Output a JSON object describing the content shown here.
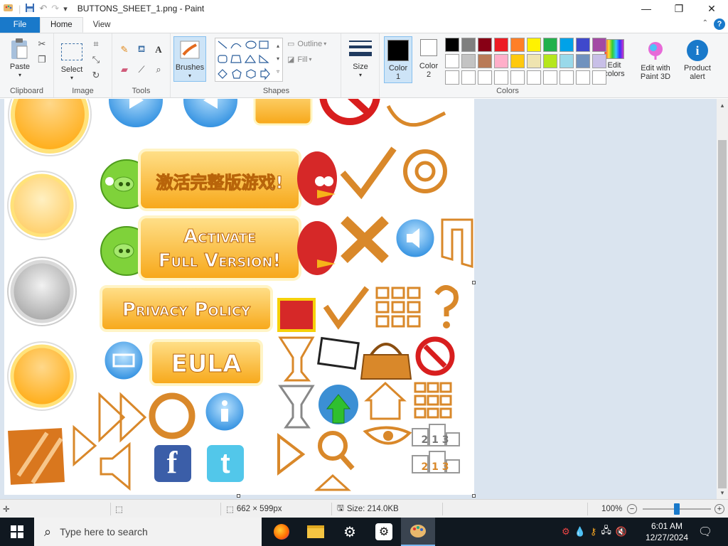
{
  "window": {
    "title": "BUTTONS_SHEET_1.png - Paint",
    "controls": {
      "minimize": "—",
      "maximize": "❐",
      "close": "✕"
    }
  },
  "quick_access": {
    "customize": "▾"
  },
  "tabs": [
    {
      "label": "File"
    },
    {
      "label": "Home"
    },
    {
      "label": "View"
    }
  ],
  "ribbon": {
    "clipboard": {
      "paste": "Paste",
      "group": "Clipboard"
    },
    "image": {
      "select": "Select",
      "group": "Image"
    },
    "tools": {
      "group": "Tools",
      "text": "A"
    },
    "brushes": {
      "label": "Brushes"
    },
    "shapes": {
      "group": "Shapes",
      "outline": "Outline",
      "fill": "Fill"
    },
    "size": {
      "label": "Size"
    },
    "colors": {
      "color1": "Color 1",
      "color2": "Color 2",
      "group": "Colors",
      "edit_colors": "Edit colors",
      "edit_paint3d": "Edit with Paint 3D",
      "product_alert": "Product alert",
      "palette_row1": [
        "#000000",
        "#7f7f7f",
        "#880015",
        "#ed1c24",
        "#ff7f27",
        "#fff200",
        "#22b14c",
        "#00a2e8",
        "#3f48cc",
        "#a349a4"
      ],
      "palette_row2": [
        "#ffffff",
        "#c3c3c3",
        "#b97a57",
        "#ffaec9",
        "#ffc90e",
        "#efe4b0",
        "#b5e61d",
        "#99d9ea",
        "#7092be",
        "#c8bfe7"
      ]
    }
  },
  "canvas": {
    "banners": {
      "chinese": "激活完整版游戏!",
      "activate_line1": "Activate",
      "activate_line2": "Full Version!",
      "privacy": "Privacy Policy",
      "eula": "EULA",
      "podium1": "2 1 3",
      "podium2": "2 1 3"
    }
  },
  "statusbar": {
    "dimensions": "662 × 599px",
    "size": "Size: 214.0KB",
    "zoom": "100%",
    "zoom_out": "−",
    "zoom_in": "+",
    "zoom_level": 0.5
  },
  "taskbar": {
    "search_placeholder": "Type here to search",
    "time": "6:01 AM",
    "date": "12/27/2024"
  }
}
